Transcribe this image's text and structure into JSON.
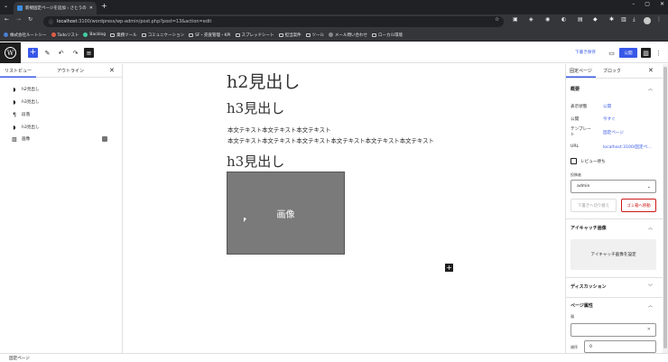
{
  "browser": {
    "tab_title": "新規固定ページを追加 ‹ さとうの…",
    "new_tab": "+",
    "url_host": "localhost",
    "url_rest": ":3100/wordpress/wp-admin/post.php?post=13&action=edit",
    "bookmarks": [
      "株式会社ルートシー",
      "Todoリスト",
      "Backlog",
      "業務ツール",
      "コミュニケーション",
      "SF・売査管理・KPI",
      "スプレッドシート",
      "担当案件",
      "ツール",
      "メール問い合わせ",
      "ローカル環境"
    ]
  },
  "toolbar": {
    "save_draft": "下書き保存",
    "publish": "公開"
  },
  "list_view": {
    "tab_list": "リストビュー",
    "tab_outline": "アウトライン",
    "items": [
      {
        "icon": "bookmark-icon",
        "label": "h2見出し"
      },
      {
        "icon": "bookmark-icon",
        "label": "h3見出し"
      },
      {
        "icon": "paragraph-icon",
        "label": "段落"
      },
      {
        "icon": "bookmark-icon",
        "label": "h3見出し"
      },
      {
        "icon": "image-icon",
        "label": "画像"
      }
    ]
  },
  "content": {
    "h2": "h2見出し",
    "h3a": "h3見出し",
    "p1": "本文テキスト本文テキスト本文テキスト",
    "p2": "本文テキスト本文テキスト本文テキスト本文テキスト本文テキスト本文テキスト",
    "h3b": "h3見出し",
    "image_placeholder": "画像"
  },
  "settings": {
    "tab_page": "固定ページ",
    "tab_block": "ブロック",
    "summary": {
      "title": "概要",
      "visibility_label": "表示状態",
      "visibility_value": "公開",
      "publish_label": "公開",
      "publish_value": "今すぐ",
      "template_label": "テンプレート",
      "template_value": "固定ページ",
      "url_label": "URL",
      "url_value": "localhost:3100/固定ペ…",
      "review_label": "レビュー待ち",
      "author_label": "投稿者",
      "author_value": "admin",
      "switch_draft": "下書きへ切り替え",
      "trash": "ゴミ箱へ移動"
    },
    "featured": {
      "title": "アイキャッチ画像",
      "button": "アイキャッチ画像を設定"
    },
    "discussion": {
      "title": "ディスカッション"
    },
    "page_attributes": {
      "title": "ページ属性",
      "parent_label": "親",
      "order_label": "順序",
      "order_value": "0"
    }
  },
  "footer": {
    "breadcrumb": "固定ページ"
  },
  "colors": {
    "accent": "#3858e9",
    "danger": "#cc1818",
    "chrome_dark": "#202124"
  }
}
